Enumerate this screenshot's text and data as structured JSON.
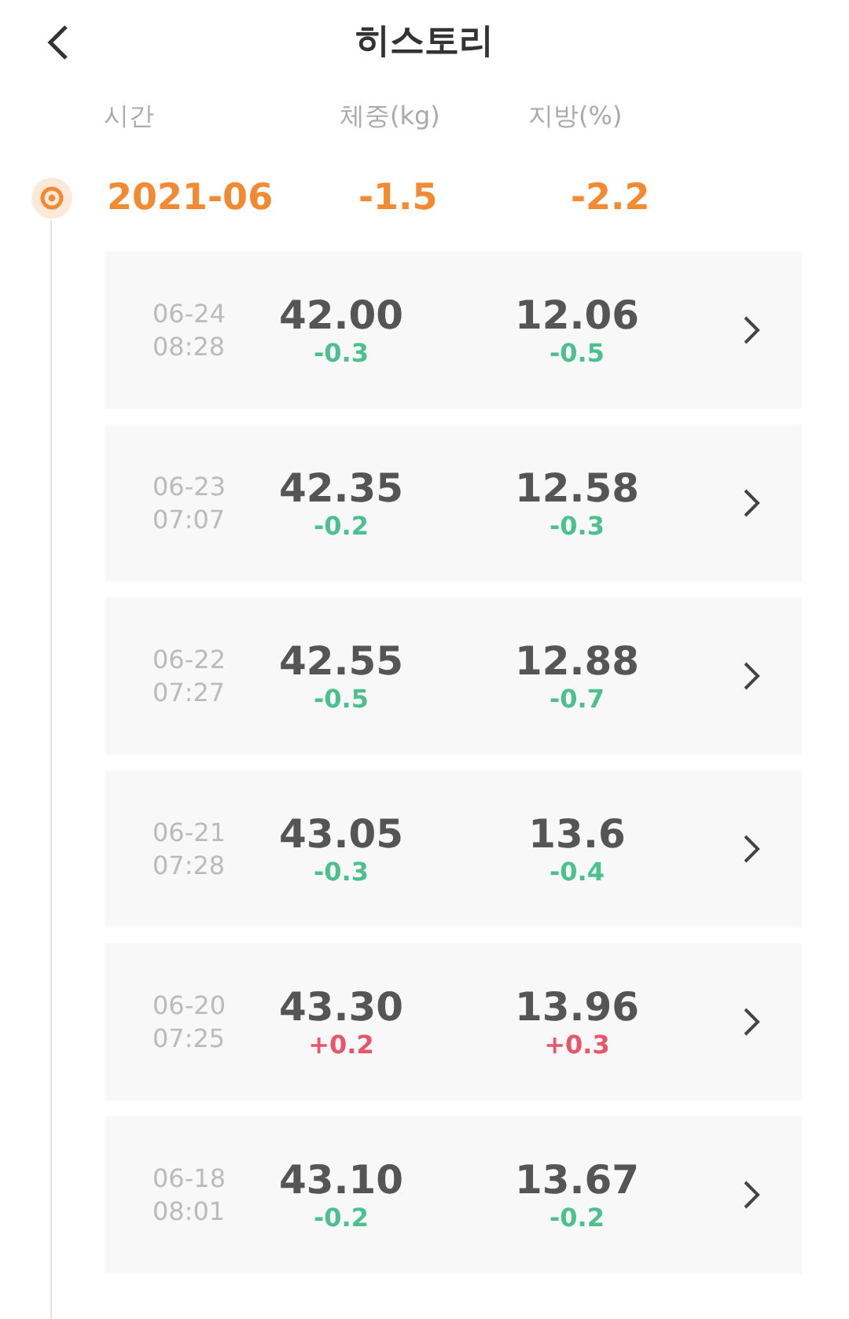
{
  "header": {
    "title": "히스토리"
  },
  "columns": [
    "시간",
    "체중(kg)",
    "지방(%)"
  ],
  "month": {
    "label": "2021-06",
    "weight_change": "-1.5",
    "fat_change": "-2.2"
  },
  "records": [
    {
      "date": "06-24",
      "time": "08:28",
      "weight": {
        "value": "42.00",
        "delta": "-0.3",
        "color": "#4cc08f"
      },
      "fat": {
        "value": "12.06",
        "delta": "-0.5",
        "color": "#4cc08f"
      }
    },
    {
      "date": "06-23",
      "time": "07:07",
      "weight": {
        "value": "42.35",
        "delta": "-0.2",
        "color": "#4cc08f"
      },
      "fat": {
        "value": "12.58",
        "delta": "-0.3",
        "color": "#4cc08f"
      }
    },
    {
      "date": "06-22",
      "time": "07:27",
      "weight": {
        "value": "42.55",
        "delta": "-0.5",
        "color": "#4cc08f"
      },
      "fat": {
        "value": "12.88",
        "delta": "-0.7",
        "color": "#4cc08f"
      }
    },
    {
      "date": "06-21",
      "time": "07:28",
      "weight": {
        "value": "43.05",
        "delta": "-0.3",
        "color": "#4cc08f"
      },
      "fat": {
        "value": "13.6",
        "delta": "-0.4",
        "color": "#4cc08f"
      }
    },
    {
      "date": "06-20",
      "time": "07:25",
      "weight": {
        "value": "43.30",
        "delta": "+0.2",
        "color": "#e8566b"
      },
      "fat": {
        "value": "13.96",
        "delta": "+0.3",
        "color": "#e8566b"
      }
    },
    {
      "date": "06-18",
      "time": "08:01",
      "weight": {
        "value": "43.10",
        "delta": "-0.2",
        "color": "#4cc08f"
      },
      "fat": {
        "value": "13.67",
        "delta": "-0.2",
        "color": "#4cc08f"
      }
    }
  ]
}
